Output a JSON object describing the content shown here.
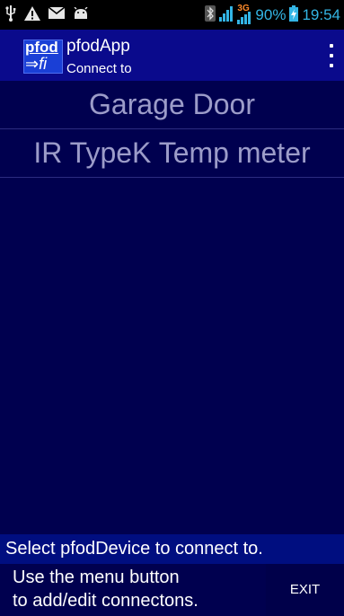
{
  "status_bar": {
    "left_icons": [
      "usb-icon",
      "warning-icon",
      "mail-icon",
      "android-icon"
    ],
    "network_label": "3G",
    "battery_percent": "90%",
    "time": "19:54"
  },
  "app_bar": {
    "logo_line1": "pfod",
    "logo_line2": "⇒fi",
    "title": "pfodApp",
    "subtitle": "Connect to"
  },
  "connections": [
    {
      "label": "Garage Door"
    },
    {
      "label": "IR TypeK Temp meter"
    }
  ],
  "message": "Select pfodDevice to connect to.",
  "help": {
    "line1": "Use the menu button",
    "line2": "to add/edit connectons."
  },
  "exit_label": "EXIT",
  "colors": {
    "app_bar": "#0a0a8c",
    "list_bg": "#00004f",
    "list_text": "#9c9cc9",
    "status_accent": "#33b5e5"
  }
}
